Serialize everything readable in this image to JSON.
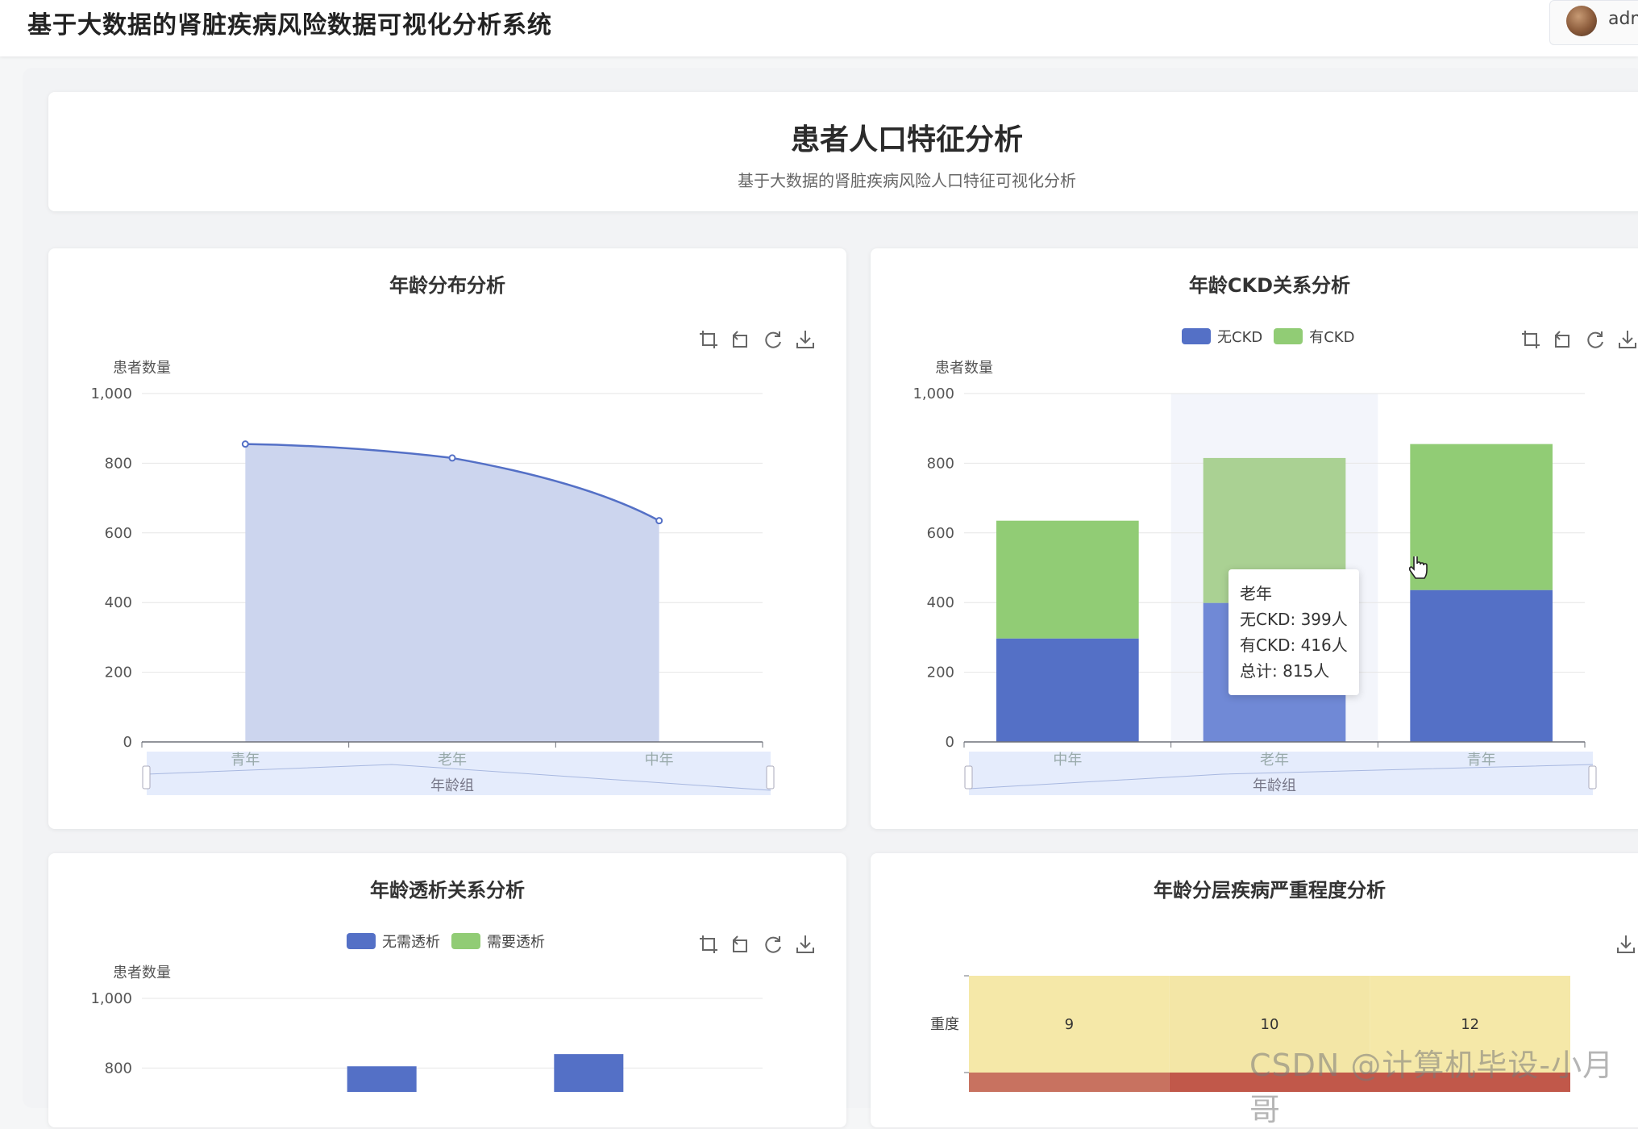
{
  "app": {
    "title": "基于大数据的肾脏疾病风险数据可视化分析系统",
    "username": "adm"
  },
  "hero": {
    "title": "患者人口特征分析",
    "subtitle": "基于大数据的肾脏疾病风险人口特征可视化分析"
  },
  "toolbox": [
    "zoom-select-icon",
    "zoom-reset-icon",
    "restore-icon",
    "download-icon"
  ],
  "colors": {
    "blue": "#5470c6",
    "green": "#91cc75",
    "yellow": "#f5e8a8",
    "red": "#c1584a"
  },
  "charts": {
    "age_dist": {
      "title": "年龄分布分析",
      "ylabel": "患者数量",
      "xlabel": "年龄组"
    },
    "age_ckd": {
      "title": "年龄CKD关系分析",
      "ylabel": "患者数量",
      "xlabel": "年龄组",
      "tooltip": {
        "title": "老年",
        "line1": "无CKD: 399人",
        "line2": "有CKD: 416人",
        "line3": "总计: 815人"
      }
    },
    "age_dialysis": {
      "title": "年龄透析关系分析",
      "ylabel": "患者数量"
    },
    "age_severity": {
      "title": "年龄分层疾病严重程度分析"
    }
  },
  "chart_data": [
    {
      "type": "area",
      "title": "年龄分布分析",
      "ylabel": "患者数量",
      "xlabel": "年龄组",
      "categories": [
        "青年",
        "老年",
        "中年"
      ],
      "values": [
        855,
        815,
        635
      ],
      "ylim": [
        0,
        1000
      ],
      "yticks": [
        "0",
        "200",
        "400",
        "600",
        "800",
        "1,000"
      ],
      "grid": true
    },
    {
      "type": "bar",
      "stacked": true,
      "title": "年龄CKD关系分析",
      "ylabel": "患者数量",
      "xlabel": "年龄组",
      "categories": [
        "中年",
        "老年",
        "青年"
      ],
      "series": [
        {
          "name": "无CKD",
          "values": [
            297,
            399,
            436
          ]
        },
        {
          "name": "有CKD",
          "values": [
            338,
            416,
            419
          ]
        }
      ],
      "ylim": [
        0,
        1000
      ],
      "yticks": [
        "0",
        "200",
        "400",
        "600",
        "800",
        "1,000"
      ],
      "legend": "top-center",
      "grid": true
    },
    {
      "type": "bar",
      "title": "年龄透析关系分析",
      "ylabel": "患者数量",
      "series": [
        {
          "name": "无需透析",
          "values": [
            805,
            840
          ]
        },
        {
          "name": "需要透析",
          "values": []
        }
      ],
      "ylim": [
        0,
        1000
      ],
      "yticks": [
        "800",
        "1,000"
      ],
      "legend": "top-center",
      "grid": true
    },
    {
      "type": "heatmap",
      "title": "年龄分层疾病严重程度分析",
      "rows": [
        "重度"
      ],
      "cells": [
        [
          9,
          10,
          12
        ]
      ]
    }
  ],
  "watermark": "CSDN @计算机毕设-小月哥"
}
